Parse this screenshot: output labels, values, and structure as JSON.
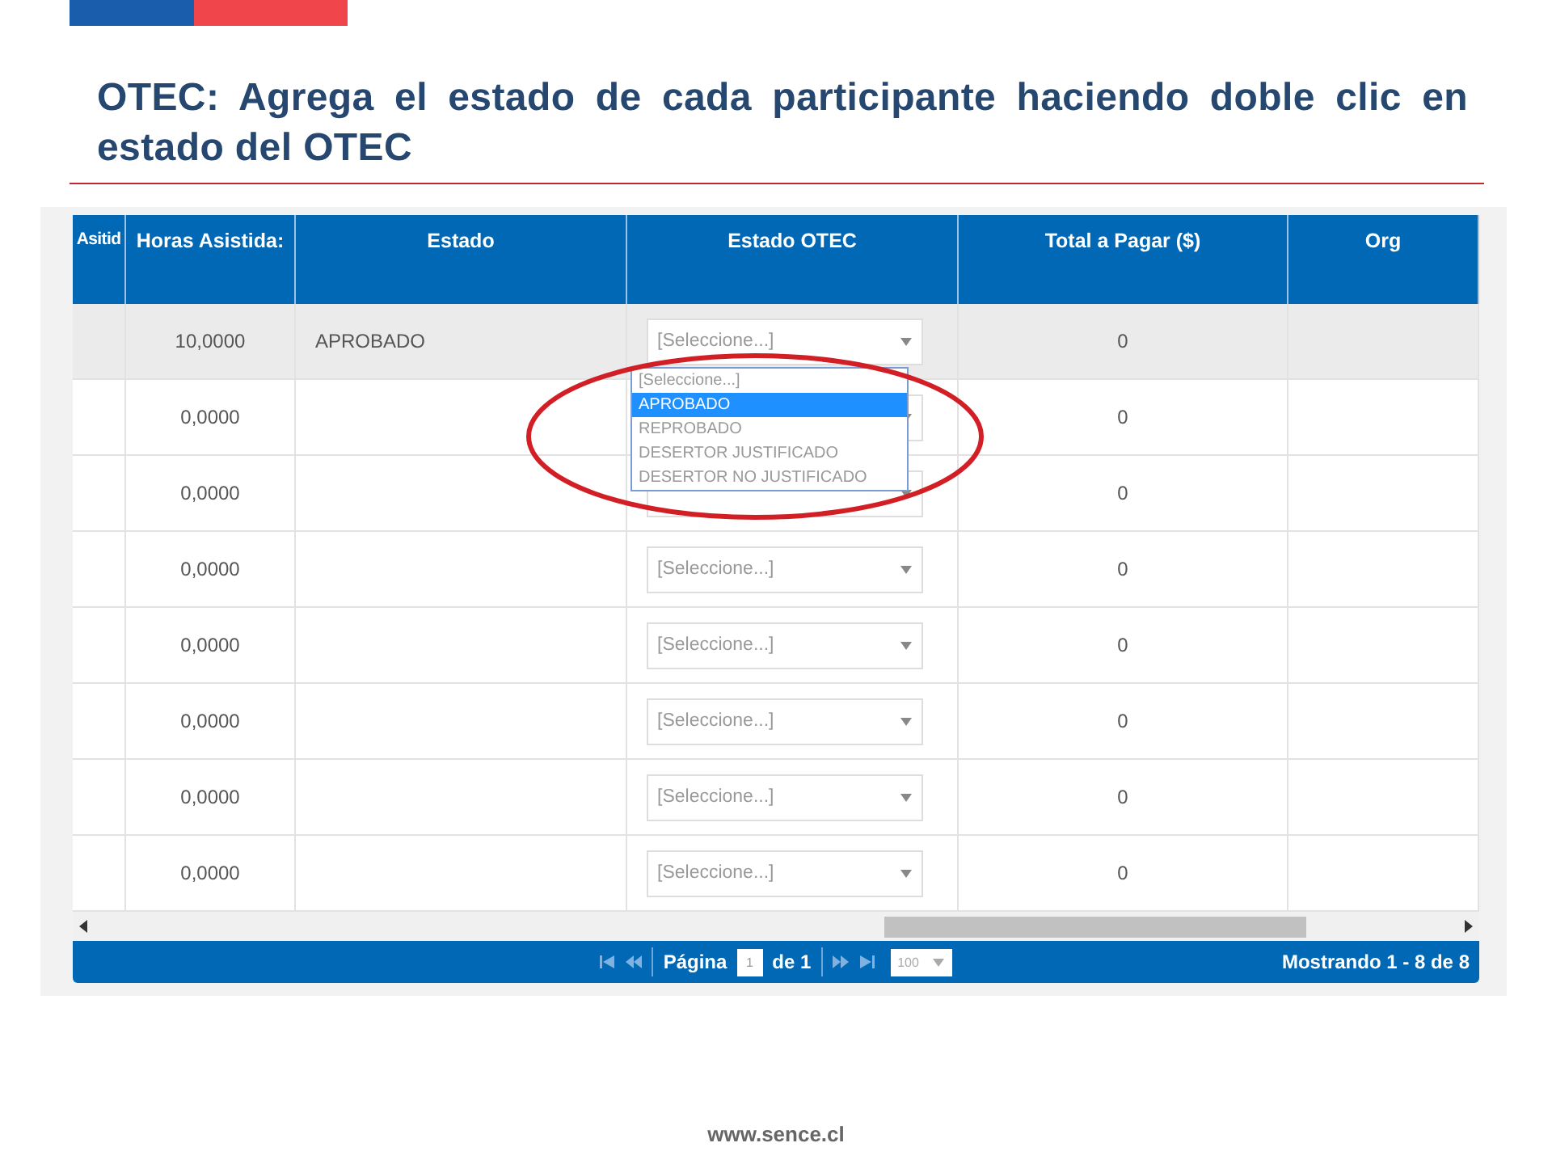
{
  "slide_title": "OTEC: Agrega el estado de cada participante haciendo doble clic en estado del OTEC",
  "table": {
    "columns": [
      "Asitid",
      "Horas Asistida:",
      "Estado",
      "Estado OTEC",
      "Total a Pagar ($)",
      "Org"
    ],
    "rows": [
      {
        "horas": "10,0000",
        "estado": "APROBADO",
        "estado_otec": "[Seleccione...]",
        "total": "0",
        "selected": true
      },
      {
        "horas": "0,0000",
        "total": "0",
        "selected": false
      },
      {
        "horas": "0,0000",
        "total": "0",
        "selected": false
      },
      {
        "horas": "0,0000",
        "estado_otec": "[Seleccione...]",
        "total": "0",
        "selected": false
      },
      {
        "horas": "0,0000",
        "estado_otec": "[Seleccione...]",
        "total": "0",
        "selected": false
      },
      {
        "horas": "0,0000",
        "estado_otec": "[Seleccione...]",
        "total": "0",
        "selected": false
      },
      {
        "horas": "0,0000",
        "estado_otec": "[Seleccione...]",
        "total": "0",
        "selected": false
      },
      {
        "horas": "0,0000",
        "estado_otec": "[Seleccione...]",
        "total": "0",
        "selected": false
      }
    ]
  },
  "dropdown_options": [
    {
      "label": "[Seleccione...]",
      "selected": false
    },
    {
      "label": "APROBADO",
      "selected": true
    },
    {
      "label": "REPROBADO",
      "selected": false
    },
    {
      "label": "DESERTOR JUSTIFICADO",
      "selected": false
    },
    {
      "label": "DESERTOR NO JUSTIFICADO",
      "selected": false
    }
  ],
  "pager": {
    "page_label": "Página",
    "page_value": "1",
    "page_total": "de 1",
    "page_size": "100",
    "summary": "Mostrando 1 - 8 de 8"
  },
  "footer": "www.sence.cl"
}
